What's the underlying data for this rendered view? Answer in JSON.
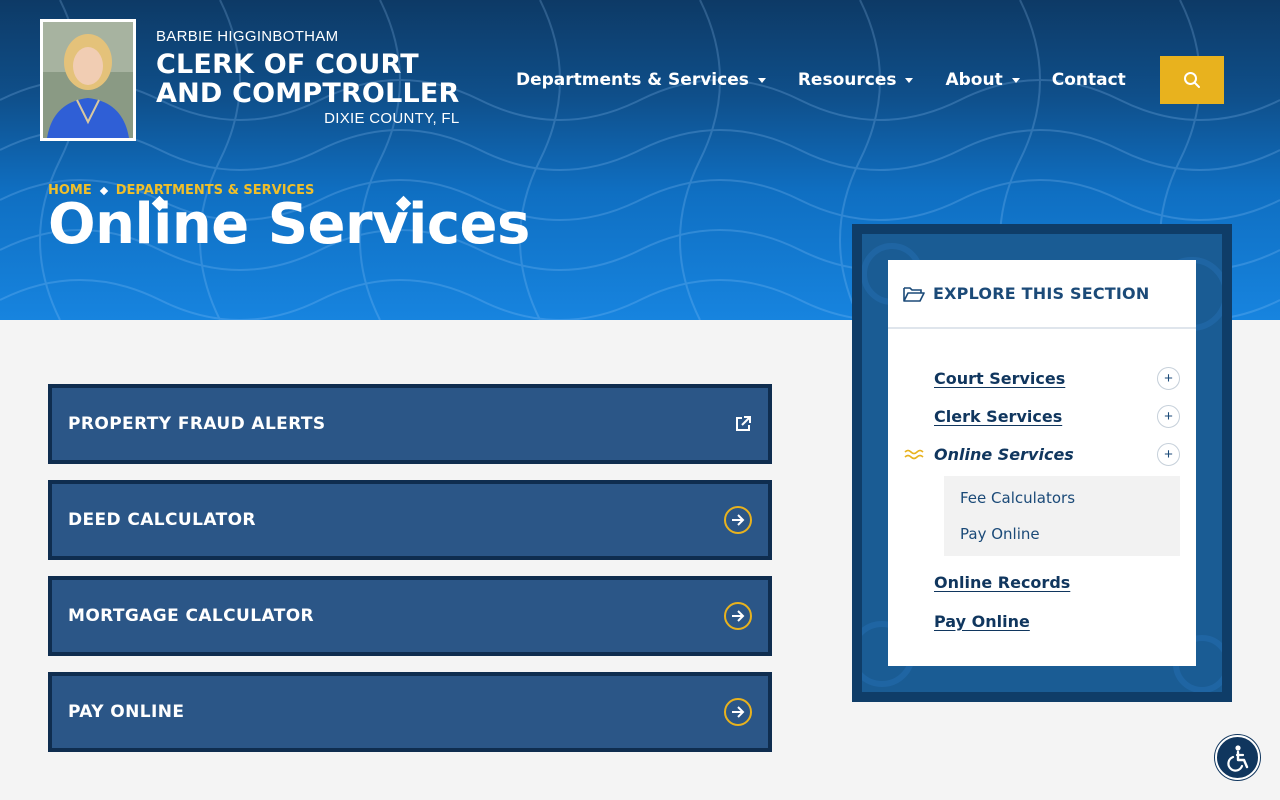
{
  "header": {
    "official_name": "BARBIE HIGGINBOTHAM",
    "office_line1": "CLERK OF COURT",
    "office_line2": "AND COMPTROLLER",
    "county": "DIXIE COUNTY, FL"
  },
  "nav": {
    "items": [
      {
        "label": "Departments & Services",
        "has_dropdown": true
      },
      {
        "label": "Resources",
        "has_dropdown": true
      },
      {
        "label": "About",
        "has_dropdown": true
      },
      {
        "label": "Contact",
        "has_dropdown": false
      }
    ],
    "search_icon": "search-icon"
  },
  "breadcrumb": {
    "home": "HOME",
    "section": "DEPARTMENTS & SERVICES"
  },
  "page": {
    "title": "Online Services"
  },
  "cards": [
    {
      "label": "PROPERTY FRAUD ALERTS",
      "icon": "external-link-icon"
    },
    {
      "label": "DEED CALCULATOR",
      "icon": "arrow-right-circle-icon"
    },
    {
      "label": "MORTGAGE CALCULATOR",
      "icon": "arrow-right-circle-icon"
    },
    {
      "label": "PAY ONLINE",
      "icon": "arrow-right-circle-icon"
    }
  ],
  "aside": {
    "title": "EXPLORE THIS SECTION",
    "items": [
      {
        "label": "Court Services",
        "expandable": true
      },
      {
        "label": "Clerk Services",
        "expandable": true
      },
      {
        "label": "Online Services",
        "expandable": true,
        "current": true
      },
      {
        "label": "Online Records",
        "expandable": false
      },
      {
        "label": "Pay Online",
        "expandable": false
      }
    ],
    "subitems": [
      {
        "label": "Fee Calculators"
      },
      {
        "label": "Pay Online"
      }
    ]
  },
  "colors": {
    "accent": "#e8b21e",
    "navy": "#10365e",
    "card_blue": "#2b5687",
    "hero_top": "#0d3a66",
    "hero_bottom": "#1784df"
  }
}
